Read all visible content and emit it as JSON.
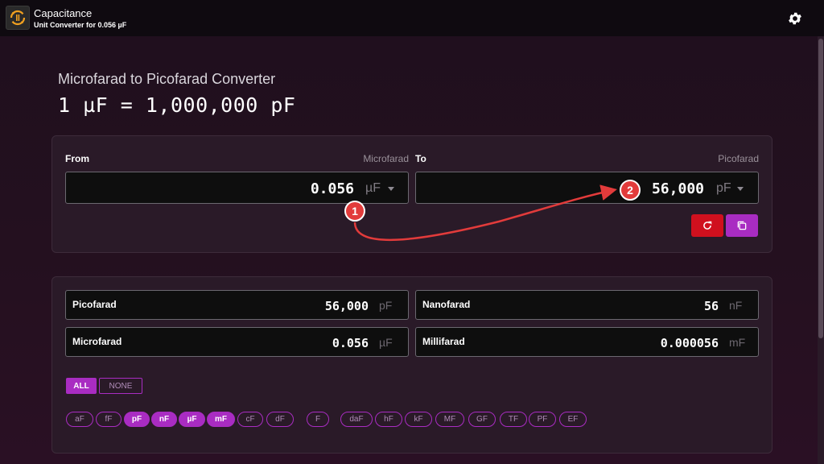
{
  "header": {
    "title": "Capacitance",
    "subtitle": "Unit Converter for 0.056 µF"
  },
  "converter": {
    "title": "Microfarad to Picofarad Converter",
    "formula": "1 µF = 1,000,000 pF"
  },
  "from": {
    "label": "From",
    "unit_name": "Microfarad",
    "value": "0.056",
    "unit": "µF"
  },
  "to": {
    "label": "To",
    "unit_name": "Picofarad",
    "value": "56,000",
    "unit": "pF"
  },
  "results": [
    {
      "name": "Picofarad",
      "value": "56,000",
      "unit": "pF"
    },
    {
      "name": "Nanofarad",
      "value": "56",
      "unit": "nF"
    },
    {
      "name": "Microfarad",
      "value": "0.056",
      "unit": "µF"
    },
    {
      "name": "Millifarad",
      "value": "0.000056",
      "unit": "mF"
    }
  ],
  "filters": {
    "all_label": "ALL",
    "none_label": "NONE"
  },
  "chips": [
    {
      "label": "aF",
      "active": false
    },
    {
      "label": "fF",
      "active": false
    },
    {
      "label": "pF",
      "active": true
    },
    {
      "label": "nF",
      "active": true
    },
    {
      "label": "µF",
      "active": true
    },
    {
      "label": "mF",
      "active": true
    },
    {
      "label": "cF",
      "active": false
    },
    {
      "label": "dF",
      "active": false
    },
    {
      "label": "F",
      "active": false
    },
    {
      "label": "daF",
      "active": false
    },
    {
      "label": "hF",
      "active": false
    },
    {
      "label": "kF",
      "active": false
    },
    {
      "label": "MF",
      "active": false
    },
    {
      "label": "GF",
      "active": false
    },
    {
      "label": "TF",
      "active": false
    },
    {
      "label": "PF",
      "active": false
    },
    {
      "label": "EF",
      "active": false
    }
  ],
  "annotations": {
    "step1": "1",
    "step2": "2"
  },
  "icons": {
    "app": "capacitor-convert-icon",
    "settings": "gear-icon",
    "reset": "refresh-icon",
    "copy": "copy-icon"
  },
  "colors": {
    "accent": "#a92cc2",
    "reset": "#d0101e",
    "annotation": "#e23b3b"
  }
}
